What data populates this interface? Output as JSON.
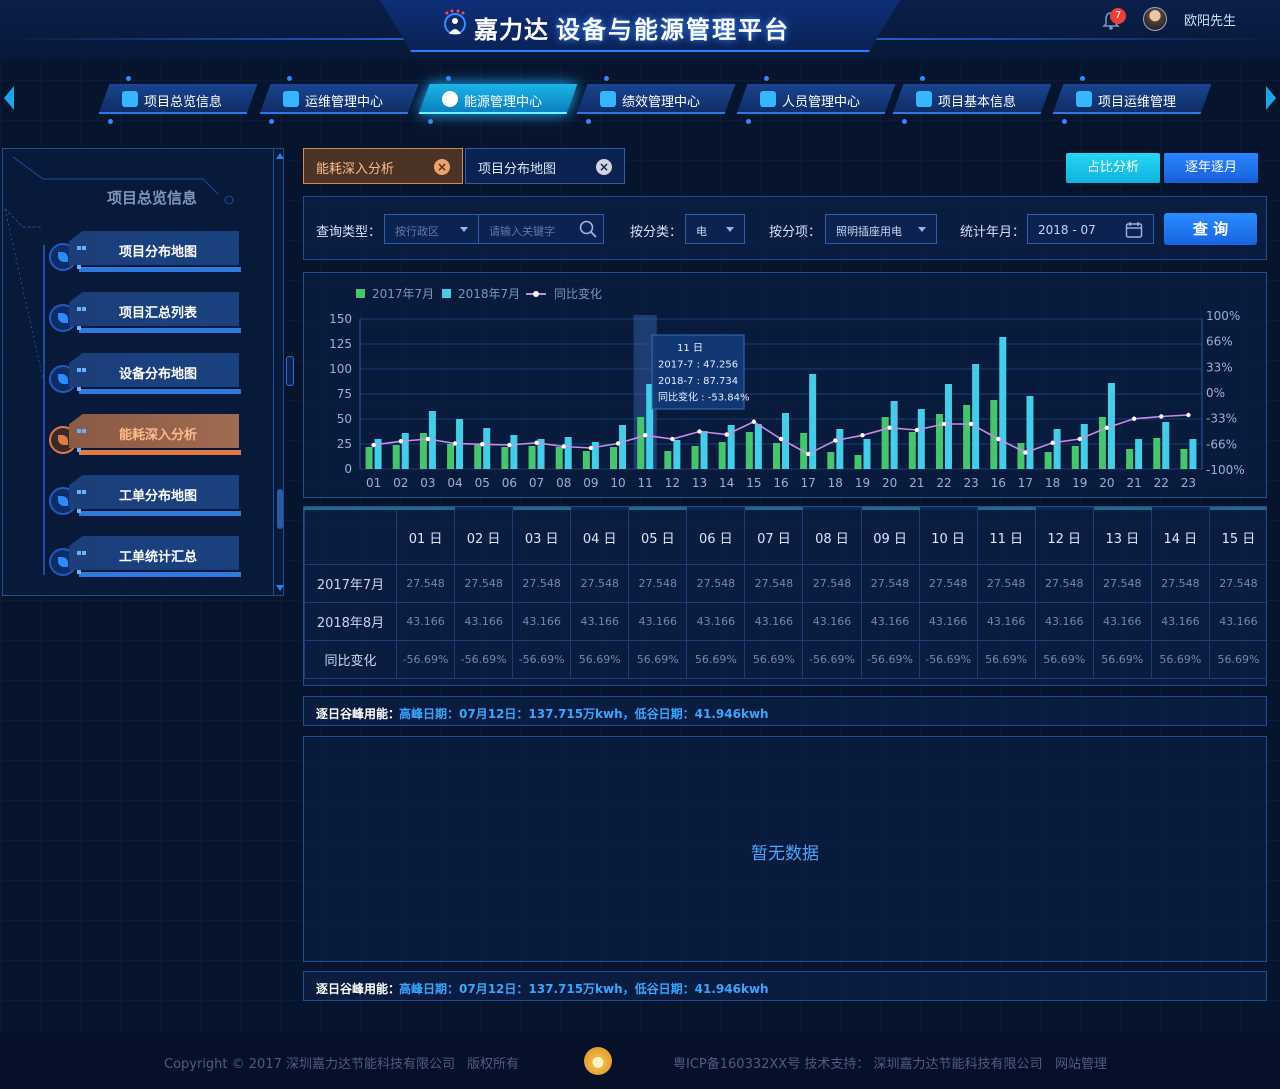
{
  "header": {
    "brand": "嘉力达",
    "title": "设备与能源管理平台",
    "notification_count": "7",
    "username": "欧阳先生"
  },
  "nav": {
    "tabs": [
      {
        "label": "项目总览信息"
      },
      {
        "label": "运维管理中心"
      },
      {
        "label": "能源管理中心",
        "active": true
      },
      {
        "label": "绩效管理中心"
      },
      {
        "label": "人员管理中心"
      },
      {
        "label": "项目基本信息"
      },
      {
        "label": "项目运维管理"
      }
    ]
  },
  "sidebar": {
    "title": "项目总览信息",
    "items": [
      {
        "label": "项目分布地图"
      },
      {
        "label": "项目汇总列表"
      },
      {
        "label": "设备分布地图"
      },
      {
        "label": "能耗深入分析",
        "active": true
      },
      {
        "label": "工单分布地图"
      },
      {
        "label": "工单统计汇总"
      }
    ]
  },
  "subtabs": [
    {
      "label": "能耗深入分析",
      "active": true
    },
    {
      "label": "项目分布地图"
    }
  ],
  "buttons": {
    "ratio": "占比分析",
    "yearly": "逐年逐月",
    "query": "查 询"
  },
  "filter": {
    "query_type_label": "查询类型：",
    "district_placeholder": "按行政区",
    "keyword_placeholder": "请输入关键字",
    "category_label": "按分类：",
    "category_value": "电",
    "item_label": "按分项：",
    "item_value": "照明插座用电",
    "month_label": "统计年月：",
    "month_value": "2018 - 07"
  },
  "chart_data": {
    "type": "bar",
    "legend": [
      "2017年7月",
      "2018年7月",
      "同比变化"
    ],
    "x": [
      "01",
      "02",
      "03",
      "04",
      "05",
      "06",
      "07",
      "08",
      "09",
      "10",
      "11",
      "12",
      "13",
      "14",
      "15",
      "16",
      "17",
      "18",
      "19",
      "20",
      "21",
      "22",
      "23",
      "16",
      "17",
      "18",
      "19",
      "20",
      "21",
      "22",
      "23"
    ],
    "series": [
      {
        "name": "2017年7月",
        "values": [
          22,
          24,
          36,
          25,
          24,
          22,
          23,
          22,
          18,
          22,
          52,
          18,
          23,
          27,
          37,
          26,
          36,
          17,
          14,
          52,
          37,
          55,
          64,
          69,
          26,
          17,
          23,
          52,
          20,
          31,
          20
        ]
      },
      {
        "name": "2018年7月",
        "values": [
          30,
          36,
          58,
          50,
          41,
          34,
          30,
          32,
          27,
          44,
          85,
          29,
          38,
          44,
          45,
          56,
          95,
          40,
          30,
          68,
          60,
          85,
          105,
          132,
          73,
          40,
          45,
          86,
          30,
          47,
          30
        ]
      },
      {
        "name": "同比变化",
        "values": [
          -68,
          -63,
          -60,
          -66,
          -67,
          -68,
          -65,
          -70,
          -72,
          -66,
          -55,
          -60,
          -50,
          -54,
          -37,
          -60,
          -80,
          -62,
          -55,
          -45,
          -48,
          -40,
          -40,
          -60,
          -78,
          -65,
          -60,
          -45,
          -33,
          -30,
          -28
        ]
      }
    ],
    "ylim_left": [
      0,
      150
    ],
    "yticks_left": [
      "0",
      "25",
      "50",
      "75",
      "100",
      "125",
      "150"
    ],
    "yticks_right": [
      "-100%",
      "-66%",
      "-33%",
      "0%",
      "33%",
      "66%",
      "100%"
    ],
    "highlight_index": 10,
    "tooltip": {
      "title": "11 日",
      "line1": "2017-7 : 47.256",
      "line2": "2018-7 : 87.734",
      "line3": "同比变化 : -53.84%"
    },
    "colors": {
      "bar2017": "#47c46e",
      "bar2018": "#45cde8",
      "line": "#c98ae8"
    }
  },
  "table": {
    "columns": [
      "01 日",
      "02 日",
      "03 日",
      "04 日",
      "05 日",
      "06 日",
      "07 日",
      "08 日",
      "09 日",
      "10 日",
      "11 日",
      "12 日",
      "13 日",
      "14 日",
      "15 日"
    ],
    "rows": [
      {
        "label": "2017年7月",
        "values": [
          "27.548",
          "27.548",
          "27.548",
          "27.548",
          "27.548",
          "27.548",
          "27.548",
          "27.548",
          "27.548",
          "27.548",
          "27.548",
          "27.548",
          "27.548",
          "27.548",
          "27.548"
        ]
      },
      {
        "label": "2018年8月",
        "values": [
          "43.166",
          "43.166",
          "43.166",
          "43.166",
          "43.166",
          "43.166",
          "43.166",
          "43.166",
          "43.166",
          "43.166",
          "43.166",
          "43.166",
          "43.166",
          "43.166",
          "43.166"
        ]
      },
      {
        "label": "同比变化",
        "values": [
          "-56.69%",
          "-56.69%",
          "-56.69%",
          "56.69%",
          "56.69%",
          "56.69%",
          "56.69%",
          "-56.69%",
          "-56.69%",
          "-56.69%",
          "56.69%",
          "56.69%",
          "56.69%",
          "56.69%",
          "56.69%"
        ]
      }
    ]
  },
  "peak": {
    "label": "逐日谷峰用能：",
    "value": "高峰日期：07月12日：137.715万kwh，低谷日期：41.946kwh"
  },
  "empty": {
    "text": "暂无数据"
  },
  "footer": {
    "copyright": "Copyright © 2017 深圳嘉力达节能科技有限公司",
    "rights": "版权所有",
    "icp": "粤ICP备160332XX号 技术支持： 深圳嘉力达节能科技有限公司",
    "admin": "网站管理"
  }
}
